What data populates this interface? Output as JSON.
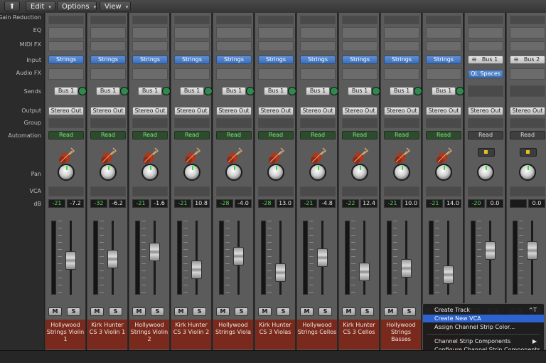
{
  "toolbar": {
    "edit_label": "Edit",
    "options_label": "Options",
    "view_label": "View"
  },
  "row_labels": {
    "gain_reduction": "Gain Reduction",
    "eq": "EQ",
    "midi_fx": "MIDI FX",
    "input": "Input",
    "audio_fx": "Audio FX",
    "sends": "Sends",
    "output": "Output",
    "group": "Group",
    "automation": "Automation",
    "pan": "Pan",
    "vca": "VCA",
    "db": "dB"
  },
  "strip_buttons": {
    "mute": "M",
    "solo": "S"
  },
  "strips": [
    {
      "input": "Strings",
      "send": "Bus 1",
      "output": "Stereo Out",
      "automation": "Read",
      "peak": "-21",
      "volume": "-7.2",
      "fader": 0.46,
      "name": "Hollywood Strings Violin 1"
    },
    {
      "input": "Strings",
      "send": "Bus 1",
      "output": "Stereo Out",
      "automation": "Read",
      "peak": "-32",
      "volume": "-6.2",
      "fader": 0.48,
      "name": "Kirk Hunter CS 3 Violin 1"
    },
    {
      "input": "Strings",
      "send": "Bus 1",
      "output": "Stereo Out",
      "automation": "Read",
      "peak": "-21",
      "volume": "-1.6",
      "fader": 0.58,
      "name": "Hollywood Strings Violin 2"
    },
    {
      "input": "Strings",
      "send": "Bus 1",
      "output": "Stereo Out",
      "automation": "Read",
      "peak": "-21",
      "volume": "10.8",
      "fader": 0.34,
      "name": "Kirk Hunter CS 3 Violin 2"
    },
    {
      "input": "Strings",
      "send": "Bus 1",
      "output": "Stereo Out",
      "automation": "Read",
      "peak": "-28",
      "volume": "-4.0",
      "fader": 0.52,
      "name": "Hollywood Strings Viola"
    },
    {
      "input": "Strings",
      "send": "Bus 1",
      "output": "Stereo Out",
      "automation": "Read",
      "peak": "-28",
      "volume": "13.0",
      "fader": 0.3,
      "name": "Kirk Hunter CS 3 Violas"
    },
    {
      "input": "Strings",
      "send": "Bus 1",
      "output": "Stereo Out",
      "automation": "Read",
      "peak": "-21",
      "volume": "-4.8",
      "fader": 0.5,
      "name": "Hollywood Strings Cellos"
    },
    {
      "input": "Strings",
      "send": "Bus 1",
      "output": "Stereo Out",
      "automation": "Read",
      "peak": "-22",
      "volume": "12.4",
      "fader": 0.31,
      "name": "Kirk Hunter CS 3 Cellos"
    },
    {
      "input": "Strings",
      "send": "Bus 1",
      "output": "Stereo Out",
      "automation": "Read",
      "peak": "-21",
      "volume": "10.0",
      "fader": 0.36,
      "name": "Hollywood Strings Basses"
    },
    {
      "input": "Strings",
      "send": "Bus 1",
      "output": "Stereo Out",
      "automation": "Read",
      "peak": "-21",
      "volume": "14.0",
      "fader": 0.27,
      "name": ""
    },
    {
      "input": "Bus 1",
      "audio_fx": "QL Spaces",
      "output": "Stereo Out",
      "automation": "Read",
      "peak": "-20",
      "volume": "0.0",
      "fader": 0.6,
      "name": ""
    },
    {
      "input": "Bus 2",
      "output": "Stereo Out",
      "automation": "Read",
      "peak": "",
      "volume": "0.0",
      "fader": 0.6,
      "name": ""
    }
  ],
  "context_menu": {
    "items": [
      {
        "label": "Create Track",
        "shortcut": "^T"
      },
      {
        "label": "Create New VCA",
        "shortcut": ""
      },
      {
        "label": "Assign Channel Strip Color...",
        "shortcut": ""
      },
      {
        "label": "Channel Strip Components",
        "shortcut": "▶"
      },
      {
        "label": "Configure Channel Strip Components",
        "shortcut": ""
      }
    ],
    "highlighted": 1
  },
  "colors": {
    "strip_bg": "#5b5b5b",
    "name_bg": "#7a2a1c",
    "input_blue": "#4a7cc4",
    "read_green": "#7fe37f",
    "menu_highlight": "#2c63cf"
  }
}
